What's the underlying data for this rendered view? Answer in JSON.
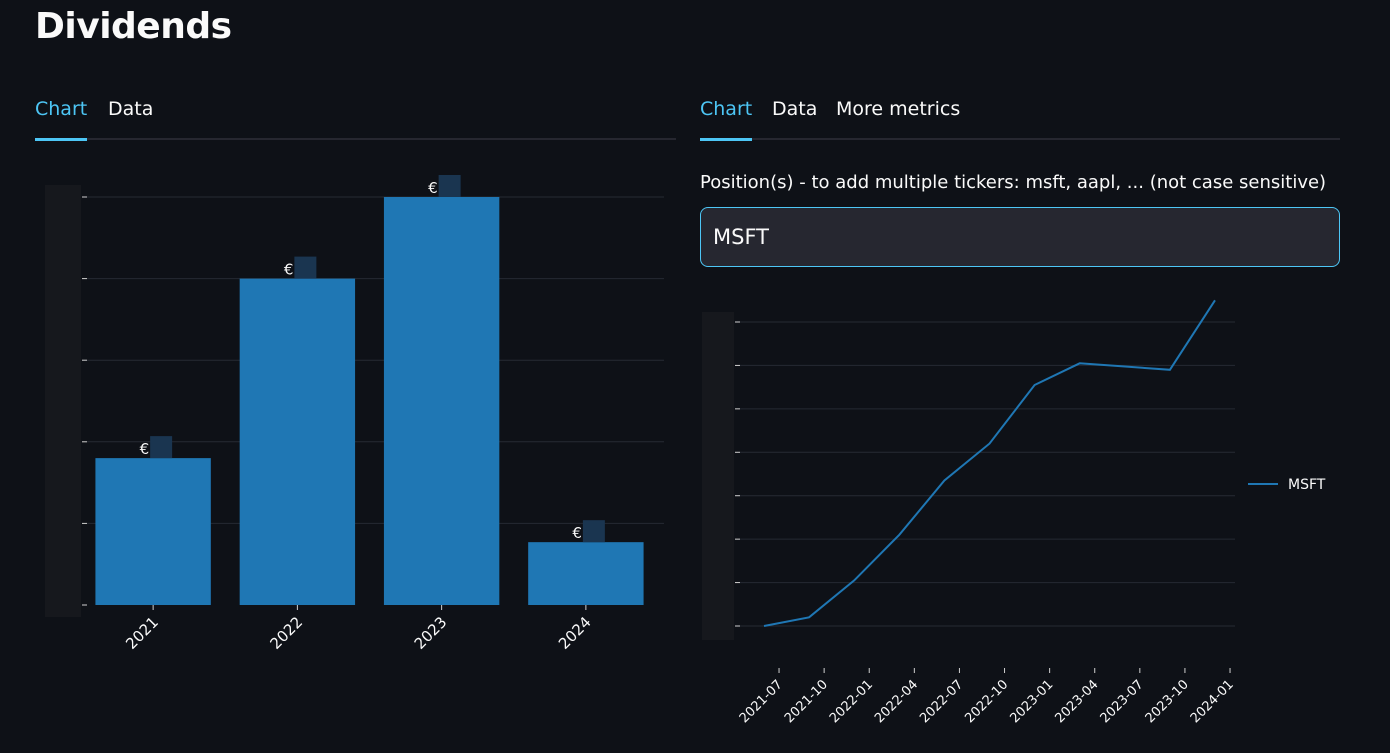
{
  "page": {
    "title": "Dividends"
  },
  "left_tabs": [
    {
      "label": "Chart",
      "active": true
    },
    {
      "label": "Data",
      "active": false
    }
  ],
  "right_tabs": [
    {
      "label": "Chart",
      "active": true
    },
    {
      "label": "Data",
      "active": false
    },
    {
      "label": "More metrics",
      "active": false
    }
  ],
  "positions_input": {
    "label": "Position(s) - to add multiple tickers: msft, aapl, ... (not case sensitive)",
    "value": "MSFT"
  },
  "colors": {
    "background": "#0e1117",
    "accent": "#4dc6f5",
    "bar": "#1f77b4",
    "line": "#1f77b4",
    "grid": "#262a33"
  },
  "chart_data": [
    {
      "type": "bar",
      "categories": [
        "2021",
        "2022",
        "2023",
        "2024"
      ],
      "values": [
        1.8,
        4.0,
        5.0,
        0.77
      ],
      "data_label_prefix": "€",
      "ylim": [
        0,
        5
      ],
      "grid": true
    },
    {
      "type": "line",
      "x": [
        "2021-06",
        "2021-09",
        "2021-12",
        "2022-03",
        "2022-06",
        "2022-09",
        "2022-12",
        "2023-03",
        "2023-09",
        "2023-12"
      ],
      "series": [
        {
          "name": "MSFT",
          "values": [
            0.0,
            0.2,
            1.05,
            2.1,
            3.35,
            4.2,
            5.55,
            6.05,
            5.9,
            7.5
          ]
        }
      ],
      "x_ticks": [
        "2021-07",
        "2021-10",
        "2022-01",
        "2022-04",
        "2022-07",
        "2022-10",
        "2023-01",
        "2023-04",
        "2023-07",
        "2023-10",
        "2024-01"
      ],
      "ylim": [
        0,
        7
      ],
      "legend": "right",
      "grid": true
    }
  ]
}
